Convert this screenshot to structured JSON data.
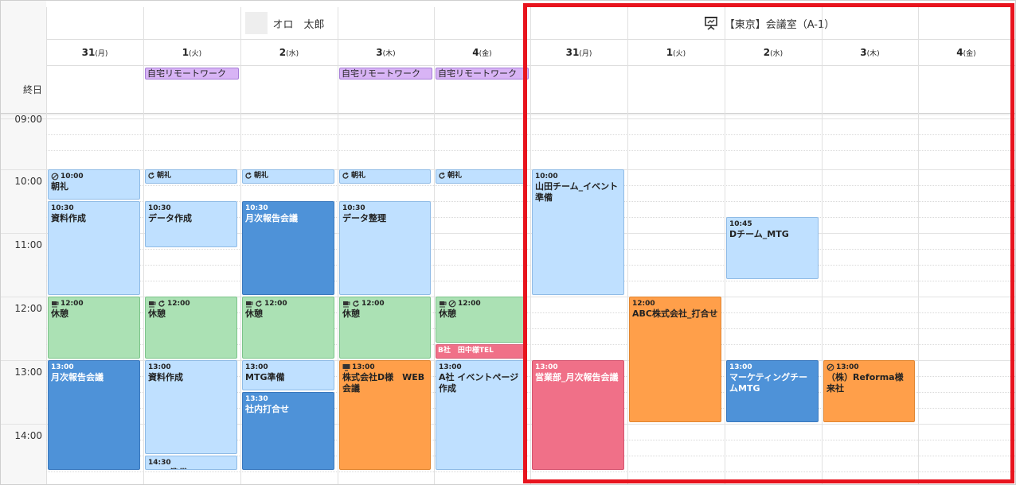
{
  "groups": [
    {
      "name": "オロ　太郎",
      "icon": "avatar"
    },
    {
      "name": "【東京】会議室（A-1）",
      "icon": "projector-icon"
    }
  ],
  "days": [
    {
      "num": "31",
      "wd": "(月)"
    },
    {
      "num": "1",
      "wd": "(火)"
    },
    {
      "num": "2",
      "wd": "(水)"
    },
    {
      "num": "3",
      "wd": "(木)"
    },
    {
      "num": "4",
      "wd": "(金)"
    }
  ],
  "allday_label": "終日",
  "time_labels": [
    "09:00",
    "10:00",
    "11:00",
    "12:00",
    "13:00",
    "14:00"
  ],
  "allday_events": [
    {
      "col": 1,
      "title": "自宅リモートワーク"
    },
    {
      "col": 3,
      "title": "自宅リモートワーク"
    },
    {
      "col": 4,
      "title": "自宅リモートワーク"
    }
  ],
  "events": [
    {
      "col": 0,
      "start": "10:00",
      "end": "10:30",
      "time": "10:00",
      "title": "朝礼",
      "color": "lb",
      "icons": [
        "no-repeat-icon"
      ]
    },
    {
      "col": 0,
      "start": "10:30",
      "end": "12:00",
      "time": "10:30",
      "title": "資料作成",
      "color": "lb",
      "icons": []
    },
    {
      "col": 0,
      "start": "12:00",
      "end": "13:00",
      "time": "12:00",
      "title": "休憩",
      "color": "gr",
      "icons": [
        "coffee-icon"
      ]
    },
    {
      "col": 0,
      "start": "13:00",
      "end": "14:45",
      "time": "13:00",
      "title": "月次報告会議",
      "color": "db",
      "icons": []
    },
    {
      "col": 1,
      "start": "10:00",
      "end": "10:15",
      "time": "",
      "title": "朝礼",
      "color": "lb",
      "short": true,
      "icons": [
        "repeat-icon"
      ]
    },
    {
      "col": 1,
      "start": "10:30",
      "end": "11:15",
      "time": "10:30",
      "title": "データ作成",
      "color": "lb",
      "icons": []
    },
    {
      "col": 1,
      "start": "12:00",
      "end": "13:00",
      "time": "12:00",
      "title": "休憩",
      "color": "gr",
      "icons": [
        "coffee-icon",
        "repeat-icon"
      ]
    },
    {
      "col": 1,
      "start": "13:00",
      "end": "14:30",
      "time": "13:00",
      "title": "資料作成",
      "color": "lb",
      "icons": []
    },
    {
      "col": 1,
      "start": "14:30",
      "end": "14:45",
      "time": "14:30",
      "title": "MTG準備",
      "color": "lb",
      "icons": []
    },
    {
      "col": 2,
      "start": "10:00",
      "end": "10:15",
      "time": "",
      "title": "朝礼",
      "color": "lb",
      "short": true,
      "icons": [
        "repeat-icon"
      ]
    },
    {
      "col": 2,
      "start": "10:30",
      "end": "12:00",
      "time": "10:30",
      "title": "月次報告会議",
      "color": "db",
      "icons": []
    },
    {
      "col": 2,
      "start": "12:00",
      "end": "13:00",
      "time": "12:00",
      "title": "休憩",
      "color": "gr",
      "icons": [
        "coffee-icon",
        "repeat-icon"
      ]
    },
    {
      "col": 2,
      "start": "13:00",
      "end": "13:30",
      "time": "13:00",
      "title": "MTG準備",
      "color": "lb",
      "icons": []
    },
    {
      "col": 2,
      "start": "13:30",
      "end": "14:45",
      "time": "13:30",
      "title": "社内打合せ",
      "color": "db",
      "icons": []
    },
    {
      "col": 3,
      "start": "10:00",
      "end": "10:15",
      "time": "",
      "title": "朝礼",
      "color": "lb",
      "short": true,
      "icons": [
        "repeat-icon"
      ]
    },
    {
      "col": 3,
      "start": "10:30",
      "end": "12:00",
      "time": "10:30",
      "title": "データ整理",
      "color": "lb",
      "icons": []
    },
    {
      "col": 3,
      "start": "12:00",
      "end": "13:00",
      "time": "12:00",
      "title": "休憩",
      "color": "gr",
      "icons": [
        "coffee-icon",
        "repeat-icon"
      ]
    },
    {
      "col": 3,
      "start": "13:00",
      "end": "14:45",
      "time": "13:00",
      "title": "株式会社D様　WEB会議",
      "color": "or",
      "icons": [
        "monitor-icon"
      ]
    },
    {
      "col": 4,
      "start": "10:00",
      "end": "10:15",
      "time": "",
      "title": "朝礼",
      "color": "lb",
      "short": true,
      "icons": [
        "repeat-icon"
      ]
    },
    {
      "col": 4,
      "start": "12:00",
      "end": "12:45",
      "time": "12:00",
      "title": "休憩",
      "color": "gr",
      "icons": [
        "coffee-icon",
        "no-repeat-icon"
      ]
    },
    {
      "col": 4,
      "start": "12:45",
      "end": "13:00",
      "time": "",
      "title": "B社　田中様TEL",
      "color": "pk",
      "short": true,
      "icons": []
    },
    {
      "col": 4,
      "start": "13:00",
      "end": "14:45",
      "time": "13:00",
      "title": "A社 イベントページ作成",
      "color": "lb",
      "icons": []
    },
    {
      "col": 5,
      "start": "10:00",
      "end": "12:00",
      "time": "10:00",
      "title": "山田チーム_イベント準備",
      "color": "lb",
      "icons": []
    },
    {
      "col": 5,
      "start": "13:00",
      "end": "14:45",
      "time": "13:00",
      "title": "営業部_月次報告会議",
      "color": "pk",
      "icons": []
    },
    {
      "col": 6,
      "start": "12:00",
      "end": "14:00",
      "time": "12:00",
      "title": "ABC株式会社_打合せ",
      "color": "or",
      "icons": []
    },
    {
      "col": 7,
      "start": "10:45",
      "end": "11:45",
      "time": "10:45",
      "title": "Dチーム_MTG",
      "color": "lb",
      "icons": []
    },
    {
      "col": 7,
      "start": "13:00",
      "end": "14:00",
      "time": "13:00",
      "title": "マーケティングチームMTG",
      "color": "db",
      "icons": []
    },
    {
      "col": 8,
      "start": "13:00",
      "end": "14:00",
      "time": "13:00",
      "title": "（株）Reforma様来社",
      "color": "or",
      "icons": [
        "no-repeat-icon"
      ]
    }
  ],
  "colors": {
    "highlight": "#e8141e",
    "allday": "#d8b4f5"
  }
}
